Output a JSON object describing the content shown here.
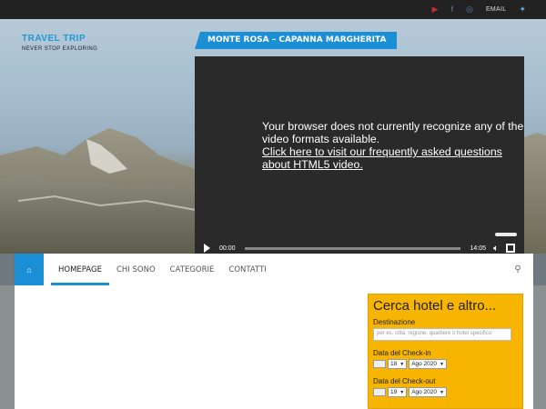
{
  "topbar": {
    "icons": [
      "youtube-icon",
      "facebook-icon",
      "instagram-icon",
      "twitter-icon"
    ],
    "email_label": "EMAIL"
  },
  "brand": {
    "title": "TRAVEL TRIP",
    "tagline": "NEVER STOP EXPLORING"
  },
  "video": {
    "tab_label": "MONTE ROSA – CAPANNA MARGHERITA",
    "message": "Your browser does not currently recognize any of the video formats available.",
    "link_text": "Click here to visit our frequently asked questions about HTML5 video.",
    "current_time": "00:00",
    "duration": "14:05"
  },
  "nav": {
    "items": [
      {
        "label": "HOMEPAGE",
        "active": true
      },
      {
        "label": "CHI SONO",
        "active": false
      },
      {
        "label": "CATEGORIE",
        "active": false
      },
      {
        "label": "CONTATTI",
        "active": false
      }
    ]
  },
  "widget": {
    "title": "Cerca hotel e altro...",
    "destination_label": "Destinazione",
    "destination_placeholder": "per es. città, regione, quartiere o hotel specifico",
    "checkin_label": "Data del Check-in",
    "checkin_day": "18",
    "checkin_month": "Ago 2020",
    "checkout_label": "Data del Check-out",
    "checkout_day": "19",
    "checkout_month": "Ago 2020"
  },
  "colors": {
    "accent": "#1a8fd6",
    "widget_bg": "#f7b500",
    "topbar_bg": "#222222"
  }
}
